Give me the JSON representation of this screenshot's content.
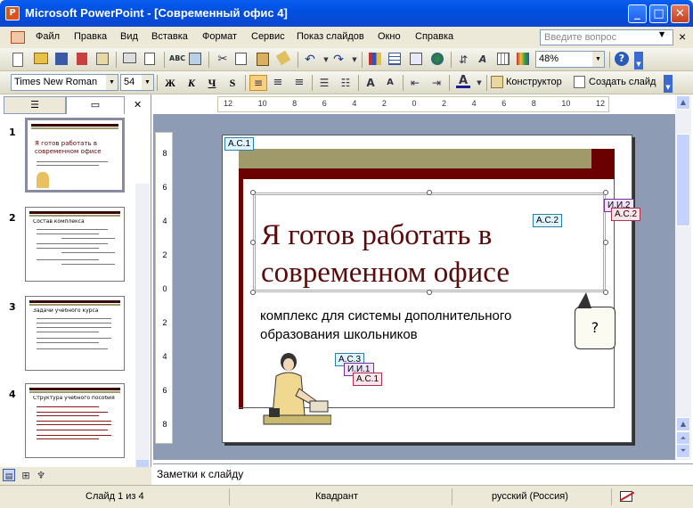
{
  "window": {
    "title": "Microsoft PowerPoint - [Современный офис 4]",
    "app_icon_letter": "P",
    "minimize": "_",
    "maximize": "□",
    "close": "✕"
  },
  "menu": {
    "items": [
      "Файл",
      "Правка",
      "Вид",
      "Вставка",
      "Формат",
      "Сервис",
      "Показ слайдов",
      "Окно",
      "Справка"
    ],
    "help_placeholder": "Введите вопрос",
    "help_close": "×"
  },
  "toolbar_standard": {
    "zoom": "48%"
  },
  "toolbar_format": {
    "font": "Times New Roman",
    "size": "54",
    "bold": "Ж",
    "italic": "К",
    "underline": "Ч",
    "shadow": "S",
    "designer_label": "Конструктор",
    "new_slide_label": "Создать слайд"
  },
  "panel": {
    "close": "✕",
    "slides": [
      {
        "number": "1",
        "title": "Я готов работать в современном офисе"
      },
      {
        "number": "2",
        "title": "Состав комплекса"
      },
      {
        "number": "3",
        "title": "Задачи учебного курса"
      },
      {
        "number": "4",
        "title": "Структура учебного пособия"
      }
    ]
  },
  "ruler": {
    "h_labels": [
      "12",
      "10",
      "8",
      "6",
      "4",
      "2",
      "0",
      "2",
      "4",
      "6",
      "8",
      "10",
      "12"
    ],
    "v_labels": [
      "8",
      "6",
      "4",
      "2",
      "0",
      "2",
      "4",
      "6",
      "8"
    ]
  },
  "slide": {
    "title": "Я готов работать в современном офисе",
    "subtitle": "комплекс для системы дополнительного образования школьников",
    "callout": "?",
    "comments": [
      {
        "label": "А.С.1"
      },
      {
        "label": "А.С.2"
      },
      {
        "label": "И.И.2"
      },
      {
        "label": "А.С.2"
      },
      {
        "label": "А.С.3"
      },
      {
        "label": "И.И.1"
      },
      {
        "label": "А.С.1"
      }
    ]
  },
  "notes": {
    "placeholder": "Заметки к слайду"
  },
  "status": {
    "slide": "Слайд 1 из 4",
    "design": "Квадрант",
    "language": "русский (Россия)"
  },
  "colors": {
    "title_bar": "#0a5ff0",
    "slide_title": "#5a0a0a",
    "dark_red": "#6b0000",
    "olive": "#a09a6a"
  }
}
